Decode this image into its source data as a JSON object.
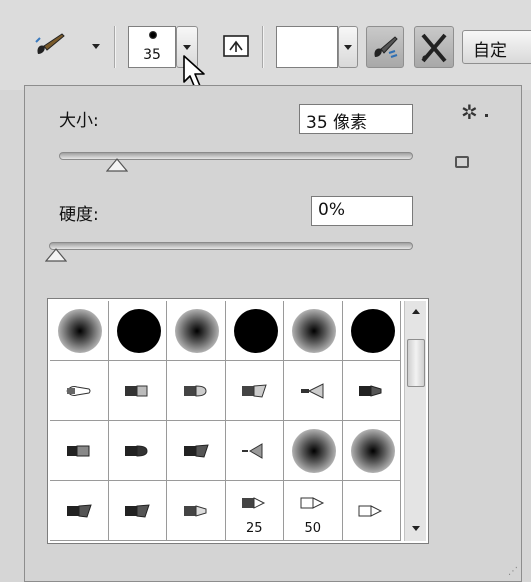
{
  "toolbar": {
    "brush_tool_icon": "brush-tool-icon",
    "brush_size_preview": "35",
    "toggle_brush_panel_icon": "toggle-brush-panel-icon",
    "airbrush_icon": "airbrush-icon",
    "pressure_icon": "pressure-size-icon",
    "mode_label": "自定"
  },
  "panel": {
    "size_label": "大小:",
    "size_value": "35 像素",
    "size_fraction": 0.15,
    "hardness_label": "硬度:",
    "hardness_value": "0%",
    "hardness_fraction": 0.0,
    "brush_grid": [
      [
        {
          "shape": "soft"
        },
        {
          "shape": "hard"
        },
        {
          "shape": "soft"
        },
        {
          "shape": "hard"
        },
        {
          "shape": "soft"
        },
        {
          "shape": "hard"
        }
      ],
      [
        {
          "shape": "tip-round"
        },
        {
          "shape": "tip-flat"
        },
        {
          "shape": "tip-round-short"
        },
        {
          "shape": "tip-angled"
        },
        {
          "shape": "tip-fan"
        },
        {
          "shape": "tip-blunt"
        }
      ],
      [
        {
          "shape": "tip-flat-dark"
        },
        {
          "shape": "tip-round-dark"
        },
        {
          "shape": "tip-angle-dark"
        },
        {
          "shape": "tip-fan-small"
        },
        {
          "shape": "soft"
        },
        {
          "shape": "soft"
        }
      ],
      [
        {
          "shape": "tip-angle-dark"
        },
        {
          "shape": "tip-angle-dark"
        },
        {
          "shape": "tip-blunt-light"
        },
        {
          "shape": "tip-pencil",
          "label": "25"
        },
        {
          "shape": "tip-pencil-light",
          "label": "50"
        },
        {
          "shape": "tip-pencil-light"
        }
      ]
    ]
  }
}
